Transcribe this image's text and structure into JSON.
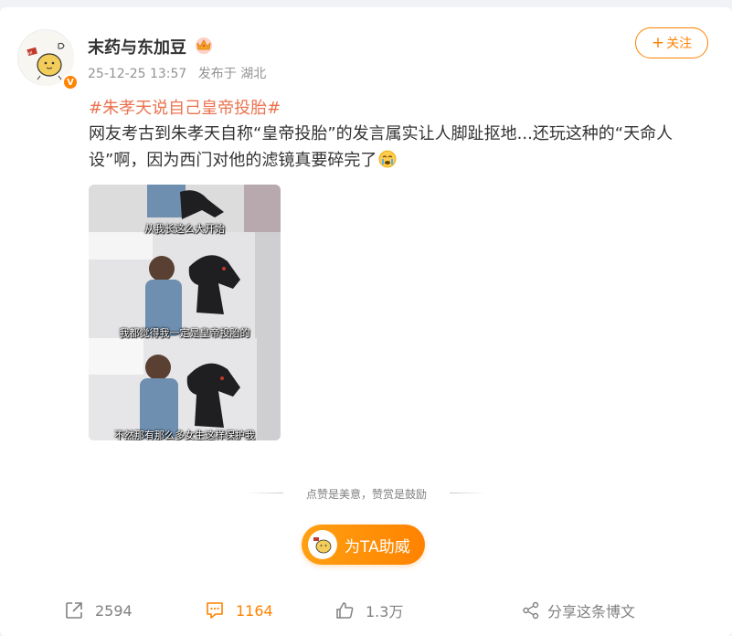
{
  "post": {
    "author": {
      "name": "末药与东加豆",
      "verified_badge": "V",
      "badge_icon": "crown-icon"
    },
    "meta": {
      "time": "25-12-25 13:57",
      "location": "发布于 湖北"
    },
    "follow_label": "关注",
    "hashtag": "#朱孝天说自己皇帝投胎#",
    "text": "网友考古到朱孝天自称“皇帝投胎”的发言属实让人脚趾抠地...还玩这种的“天命人设”啊，因为西门对他的滤镜真要碎完了",
    "text_emoji": "crying-face-emoji",
    "media": {
      "subtitles": [
        "从我长这么大开始",
        "我都觉得我一定是皇帝投胎的",
        "不然那有那么多女生这样保护我"
      ]
    },
    "support_caption": "点赞是美意，赞赏是鼓励",
    "cheer_label": "为TA助威"
  },
  "actions": {
    "repost_count": "2594",
    "comment_count": "1164",
    "like_count": "1.3万",
    "share_label": "分享这条博文"
  },
  "colors": {
    "accent": "#ff8200",
    "hashtag": "#eb7350",
    "muted": "#939393"
  }
}
